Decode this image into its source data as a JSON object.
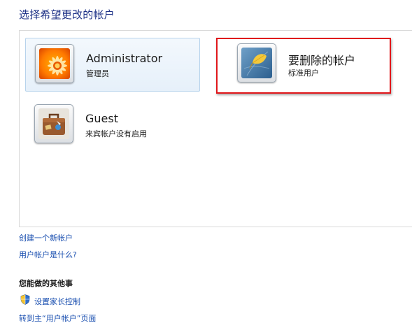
{
  "page_title": "选择希望更改的帐户",
  "accounts": [
    {
      "name": "Administrator",
      "type": "管理员",
      "avatar_icon": "flower-avatar-icon",
      "selected": true
    },
    {
      "name": "要删除的帐户",
      "type": "标准用户",
      "avatar_icon": "leaf-avatar-icon",
      "selected": false
    },
    {
      "name": "Guest",
      "type": "来宾帐户没有启用",
      "avatar_icon": "suitcase-avatar-icon",
      "selected": false
    }
  ],
  "links": {
    "create_account": "创建一个新帐户",
    "what_is_account": "用户帐户是什么?"
  },
  "other_section": {
    "heading": "您能做的其他事",
    "parental_controls": "设置家长控制",
    "goto_main": "转到主“用户帐户”页面"
  },
  "colors": {
    "link": "#1a4fb0",
    "title": "#1e3287",
    "highlight": "#e0161a",
    "selected_tile_border": "#b7d3ec"
  }
}
